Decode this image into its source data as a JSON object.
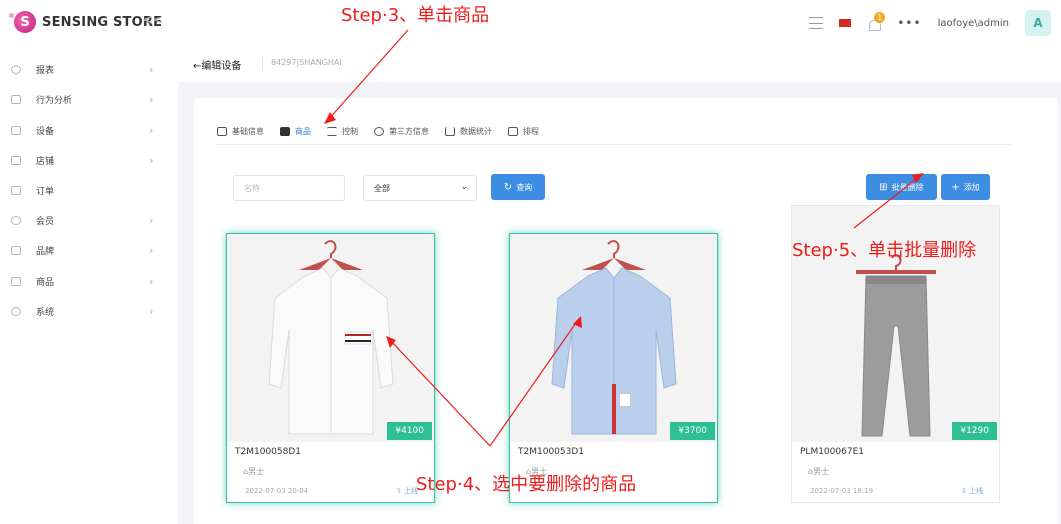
{
  "topbar": {
    "brand": "SENSING STORE",
    "collapse_icon": "double-chevron-left-icon",
    "notification_count": "1",
    "more": "•••",
    "user": "laofoye\\admin",
    "avatar_letter": "A"
  },
  "sidebar": {
    "items": [
      {
        "label": "报表",
        "icon": "dashboard-icon",
        "has_arrow": true
      },
      {
        "label": "行为分析",
        "icon": "document-icon",
        "has_arrow": true
      },
      {
        "label": "设备",
        "icon": "device-icon",
        "has_arrow": true
      },
      {
        "label": "店铺",
        "icon": "store-icon",
        "has_arrow": true
      },
      {
        "label": "订单",
        "icon": "order-icon",
        "has_arrow": false
      },
      {
        "label": "会员",
        "icon": "member-icon",
        "has_arrow": true
      },
      {
        "label": "品牌",
        "icon": "crown-icon",
        "has_arrow": true
      },
      {
        "label": "商品",
        "icon": "box-icon",
        "has_arrow": true
      },
      {
        "label": "系统",
        "icon": "gear-icon",
        "has_arrow": true
      }
    ],
    "arrow": "›"
  },
  "page": {
    "back_label": "←编辑设备",
    "breadcrumb": "84297|SHANGHAI"
  },
  "tabs": [
    {
      "label": "基础信息",
      "icon": "form-icon",
      "active": false
    },
    {
      "label": "商品",
      "icon": "box-icon",
      "active": true
    },
    {
      "label": "控制",
      "icon": "sliders-icon",
      "active": false
    },
    {
      "label": "第三方信息",
      "icon": "shield-icon",
      "active": false
    },
    {
      "label": "数据统计",
      "icon": "bar-chart-icon",
      "active": false
    },
    {
      "label": "排程",
      "icon": "schedule-icon",
      "active": false
    }
  ],
  "filters": {
    "name_placeholder": "名称",
    "select_value": "全部",
    "search_label": "查询",
    "batch_delete_label": "批量删除",
    "add_label": "添加"
  },
  "products": [
    {
      "sku": "T2M100058D1",
      "price": "¥4100",
      "tag": "男士",
      "date": "2022-07-03 20:04",
      "status": "上线",
      "selected": true,
      "image": "white-shirt"
    },
    {
      "sku": "T2M100053D1",
      "price": "¥3700",
      "tag": "男士",
      "date": "",
      "status": "",
      "selected": true,
      "image": "blue-shirt"
    },
    {
      "sku": "PLM100067E1",
      "price": "¥1290",
      "tag": "男士",
      "date": "2022-07-03 18:19",
      "status": "上线",
      "selected": false,
      "image": "grey-pants"
    }
  ],
  "annotations": {
    "step3": "Step·3、单击商品",
    "step4": "Step·4、选中要删除的商品",
    "step5": "Step·5、单击批量删除"
  },
  "colors": {
    "accent": "#3d8de3",
    "price": "#2fbf95",
    "selected_border": "#34c2a6",
    "annotation": "#ee1c1c"
  }
}
